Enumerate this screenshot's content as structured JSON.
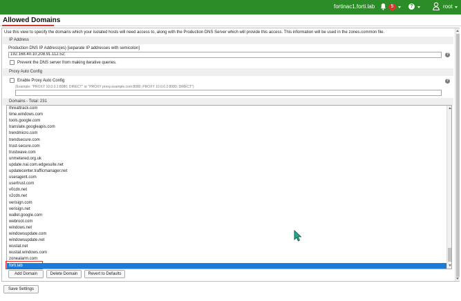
{
  "topbar": {
    "host": "fortinac1.forti.lab",
    "notification_count": "5",
    "help_glyph": "?",
    "user": "root",
    "bar_color": "#2c8c27"
  },
  "page": {
    "title": "Allowed Domains",
    "intro": "Use this view to specify the domains which your isolated hosts will need access to, along with the Production DNS Server which will provide this access. This information will be used in the zones.common file."
  },
  "ip_section": {
    "header": "IP Address",
    "dns_label": "Production DNS IP Address(es) [separate IP addresses with semicolon]",
    "dns_value": "192.168.40.10;208.91.112.52;",
    "prevent_label": "Prevent the DNS server from making iterative queries."
  },
  "proxy_section": {
    "header": "Proxy Auto Config",
    "enable_label": "Enable Proxy Auto Config",
    "example": "(Example: \"PROXY 10.0.0.1:8080; DIRECT\" or \"PROXY proxy.example.com:8080; PROXY 10.0.0.2:8080; DIRECT\")",
    "value": ""
  },
  "domains": {
    "header": "Domains - Total: 231",
    "items": [
      "threattrack.com",
      "time.windows.com",
      "tools.google.com",
      "translate.googleapis.com",
      "trendmicro.com",
      "trendsecure.com",
      "trust-secure.com",
      "trustwave.com",
      "unmetered.org.uk",
      "update.nai.com.edgesuite.net",
      "updatecenter.trafficmanager.net",
      "useragent.com",
      "usertrust.com",
      "v0cdn.net",
      "v2cdn.net",
      "verisign.com",
      "verisign.net",
      "wallet.google.com",
      "webroot.com",
      "windows.net",
      "windowsupdate.com",
      "windowsupdate.net",
      "wustat.net",
      "wustat.windows.com",
      "zonealarm.com",
      "forti.lab"
    ],
    "selected": "forti.lab",
    "selection_color": "#1c7bd9"
  },
  "buttons": {
    "add": "Add Domain",
    "delete": "Delete Domain",
    "revert": "Revert to Defaults",
    "save": "Save Settings"
  }
}
